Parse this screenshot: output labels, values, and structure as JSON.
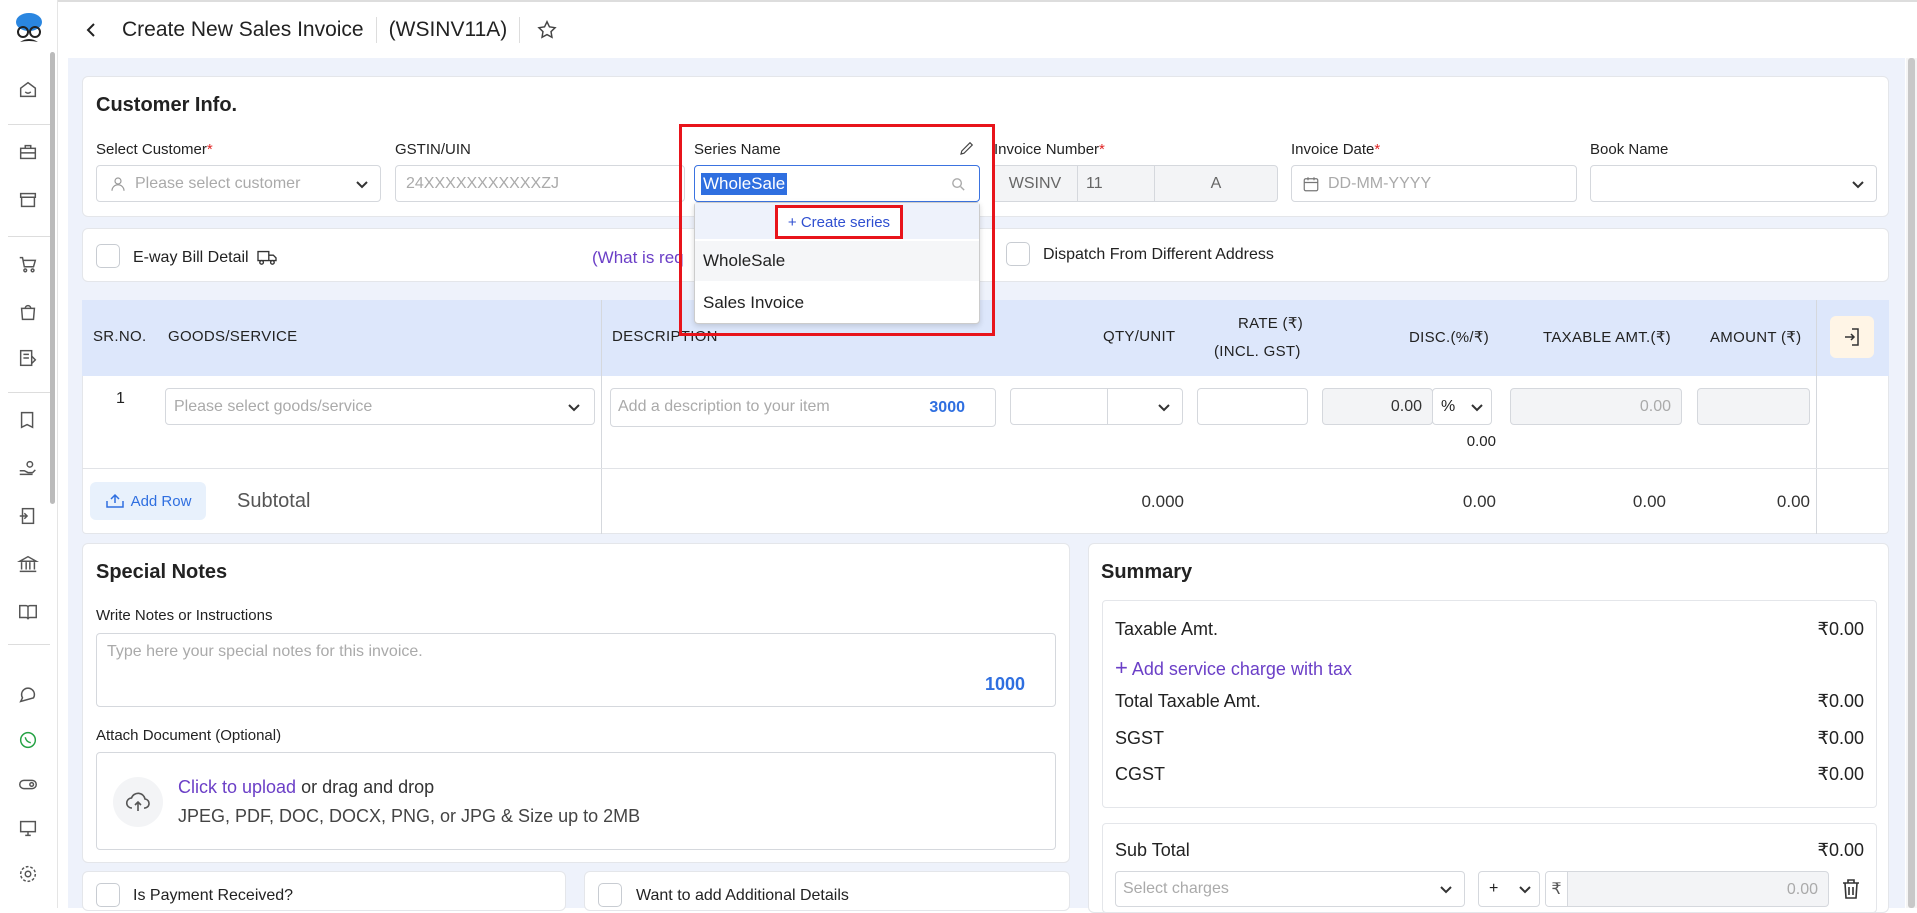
{
  "header": {
    "title": "Create New Sales Invoice",
    "code": "(WSINV11A)"
  },
  "customer": {
    "heading": "Customer Info.",
    "select_customer_label": "Select Customer",
    "select_customer_placeholder": "Please select customer",
    "gstin_label": "GSTIN/UIN",
    "gstin_placeholder": "24XXXXXXXXXXXZJ",
    "series_label": "Series Name",
    "series_value": "WholeSale",
    "invoice_number_label": "Invoice Number",
    "invoice_prefix": "WSINV",
    "invoice_number": "11",
    "invoice_suffix": "A",
    "invoice_date_label": "Invoice Date",
    "invoice_date_placeholder": "DD-MM-YYYY",
    "book_name_label": "Book Name"
  },
  "series_dropdown": {
    "create_label": "+ Create series",
    "options": [
      "WholeSale",
      "Sales Invoice"
    ]
  },
  "eway": {
    "label": "E-way Bill Detail",
    "what_is": "(What is req",
    "dispatch_label": "Dispatch From Different Address"
  },
  "table": {
    "headers": {
      "srno": "SR.NO.",
      "goods": "GOODS/SERVICE",
      "desc": "DESCRIPTION",
      "qty": "QTY/UNIT",
      "rate1": "RATE (₹)",
      "rate2": "(INCL. GST)",
      "disc": "DISC.(%/₹)",
      "taxable": "TAXABLE AMT.(₹)",
      "amount": "AMOUNT (₹)"
    },
    "row": {
      "sr": "1",
      "goods_placeholder": "Please select goods/service",
      "desc_placeholder": "Add a description to your item",
      "desc_count": "3000",
      "disc_value": "0.00",
      "disc_unit": "%",
      "disc_amount": "0.00",
      "taxable": "0.00"
    },
    "add_row": "Add Row",
    "subtotal_label": "Subtotal",
    "subtotal": {
      "qty": "0.000",
      "disc": "0.00",
      "taxable": "0.00",
      "amount": "0.00"
    }
  },
  "notes": {
    "heading": "Special Notes",
    "label": "Write Notes or Instructions",
    "placeholder": "Type here your special notes for this invoice.",
    "count": "1000",
    "attach_label": "Attach Document (Optional)",
    "upload_link": "Click to upload",
    "upload_rest": "or drag and drop",
    "upload_hint": "JPEG, PDF, DOC, DOCX, PNG, or JPG & Size up to 2MB"
  },
  "payment": {
    "received_label": "Is Payment Received?",
    "additional_label": "Want to add Additional Details"
  },
  "summary": {
    "heading": "Summary",
    "taxable_label": "Taxable Amt.",
    "taxable_value": "₹0.00",
    "service_charge": "Add service charge with tax",
    "total_taxable_label": "Total Taxable Amt.",
    "total_taxable_value": "₹0.00",
    "sgst_label": "SGST",
    "sgst_value": "₹0.00",
    "cgst_label": "CGST",
    "cgst_value": "₹0.00",
    "subtotal_label": "Sub Total",
    "subtotal_value": "₹0.00",
    "charges_placeholder": "Select charges",
    "sign": "+",
    "currency": "₹",
    "charge_value": "0.00"
  }
}
